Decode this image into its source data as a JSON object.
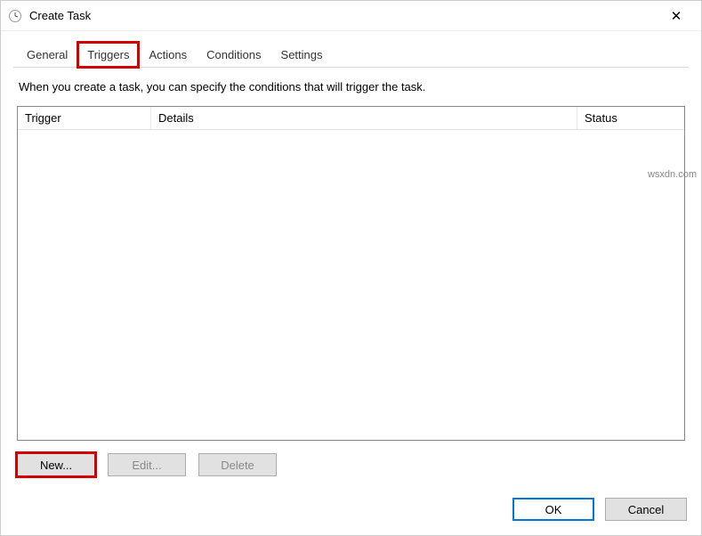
{
  "window": {
    "title": "Create Task",
    "close_glyph": "✕"
  },
  "tabs": {
    "general": "General",
    "triggers": "Triggers",
    "actions": "Actions",
    "conditions": "Conditions",
    "settings": "Settings"
  },
  "description": "When you create a task, you can specify the conditions that will trigger the task.",
  "columns": {
    "trigger": "Trigger",
    "details": "Details",
    "status": "Status"
  },
  "buttons": {
    "new": "New...",
    "edit": "Edit...",
    "delete": "Delete",
    "ok": "OK",
    "cancel": "Cancel"
  },
  "watermark": "wsxdn.com"
}
